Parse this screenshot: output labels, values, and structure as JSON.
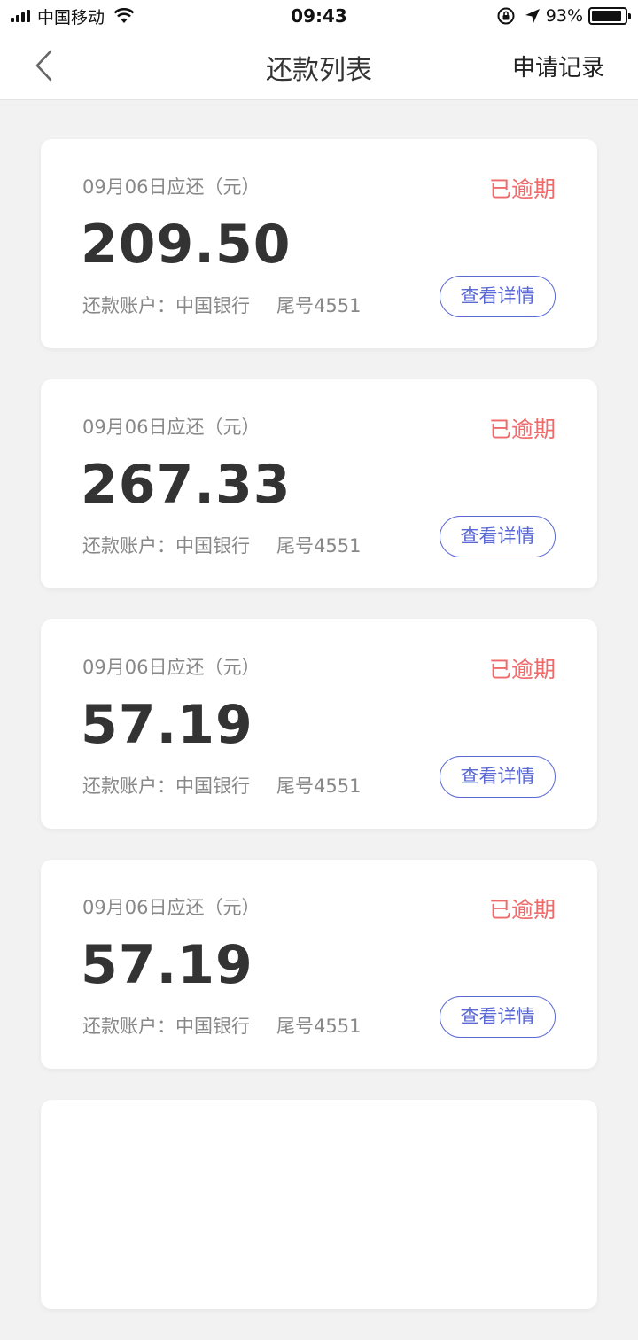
{
  "status_bar": {
    "carrier": "中国移动",
    "time": "09:43",
    "battery": "93%",
    "battery_level": 0.93,
    "icons": [
      "signal-icon",
      "wifi-icon",
      "rotation-lock-icon",
      "location-arrow-icon",
      "battery-icon"
    ]
  },
  "nav": {
    "title": "还款列表",
    "right_action": "申请记录",
    "back_icon": "chevron-left-icon"
  },
  "repayments": [
    {
      "due_label": "09月06日应还（元）",
      "status": "已逾期",
      "amount": "209.50",
      "account_label": "还款账户：中国银行",
      "account_tail": "尾号4551",
      "detail_button": "查看详情"
    },
    {
      "due_label": "09月06日应还（元）",
      "status": "已逾期",
      "amount": "267.33",
      "account_label": "还款账户：中国银行",
      "account_tail": "尾号4551",
      "detail_button": "查看详情"
    },
    {
      "due_label": "09月06日应还（元）",
      "status": "已逾期",
      "amount": "57.19",
      "account_label": "还款账户：中国银行",
      "account_tail": "尾号4551",
      "detail_button": "查看详情"
    },
    {
      "due_label": "09月06日应还（元）",
      "status": "已逾期",
      "amount": "57.19",
      "account_label": "还款账户：中国银行",
      "account_tail": "尾号4551",
      "detail_button": "查看详情"
    }
  ],
  "colors": {
    "overdue": "#ef6b6b",
    "accent": "#5a69d4",
    "background": "#f2f2f2"
  }
}
